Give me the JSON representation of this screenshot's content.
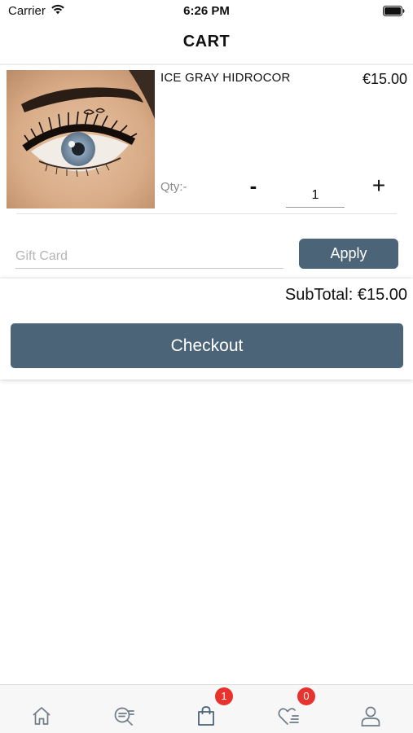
{
  "status_bar": {
    "carrier": "Carrier",
    "time": "6:26 PM"
  },
  "header": {
    "title": "CART"
  },
  "cart": {
    "items": [
      {
        "name": "ICE GRAY HIDROCOR",
        "price": "€15.00",
        "qty_label": "Qty:-",
        "quantity": "1",
        "minus_label": "-",
        "plus_label": "+"
      }
    ]
  },
  "gift_card": {
    "placeholder": "Gift Card",
    "value": "",
    "apply_label": "Apply"
  },
  "summary": {
    "subtotal": "SubTotal: €15.00",
    "checkout_label": "Checkout"
  },
  "tab_bar": {
    "tabs": [
      {
        "name": "home",
        "icon": "home-icon"
      },
      {
        "name": "search",
        "icon": "search-list-icon"
      },
      {
        "name": "cart",
        "icon": "shopping-bag-icon",
        "badge": "1"
      },
      {
        "name": "wishlist",
        "icon": "heart-list-icon",
        "badge": "0"
      },
      {
        "name": "profile",
        "icon": "user-icon"
      }
    ]
  },
  "colors": {
    "primary": "#4c6478",
    "badge": "#e8322e",
    "tab_icon": "#6f7b86"
  }
}
